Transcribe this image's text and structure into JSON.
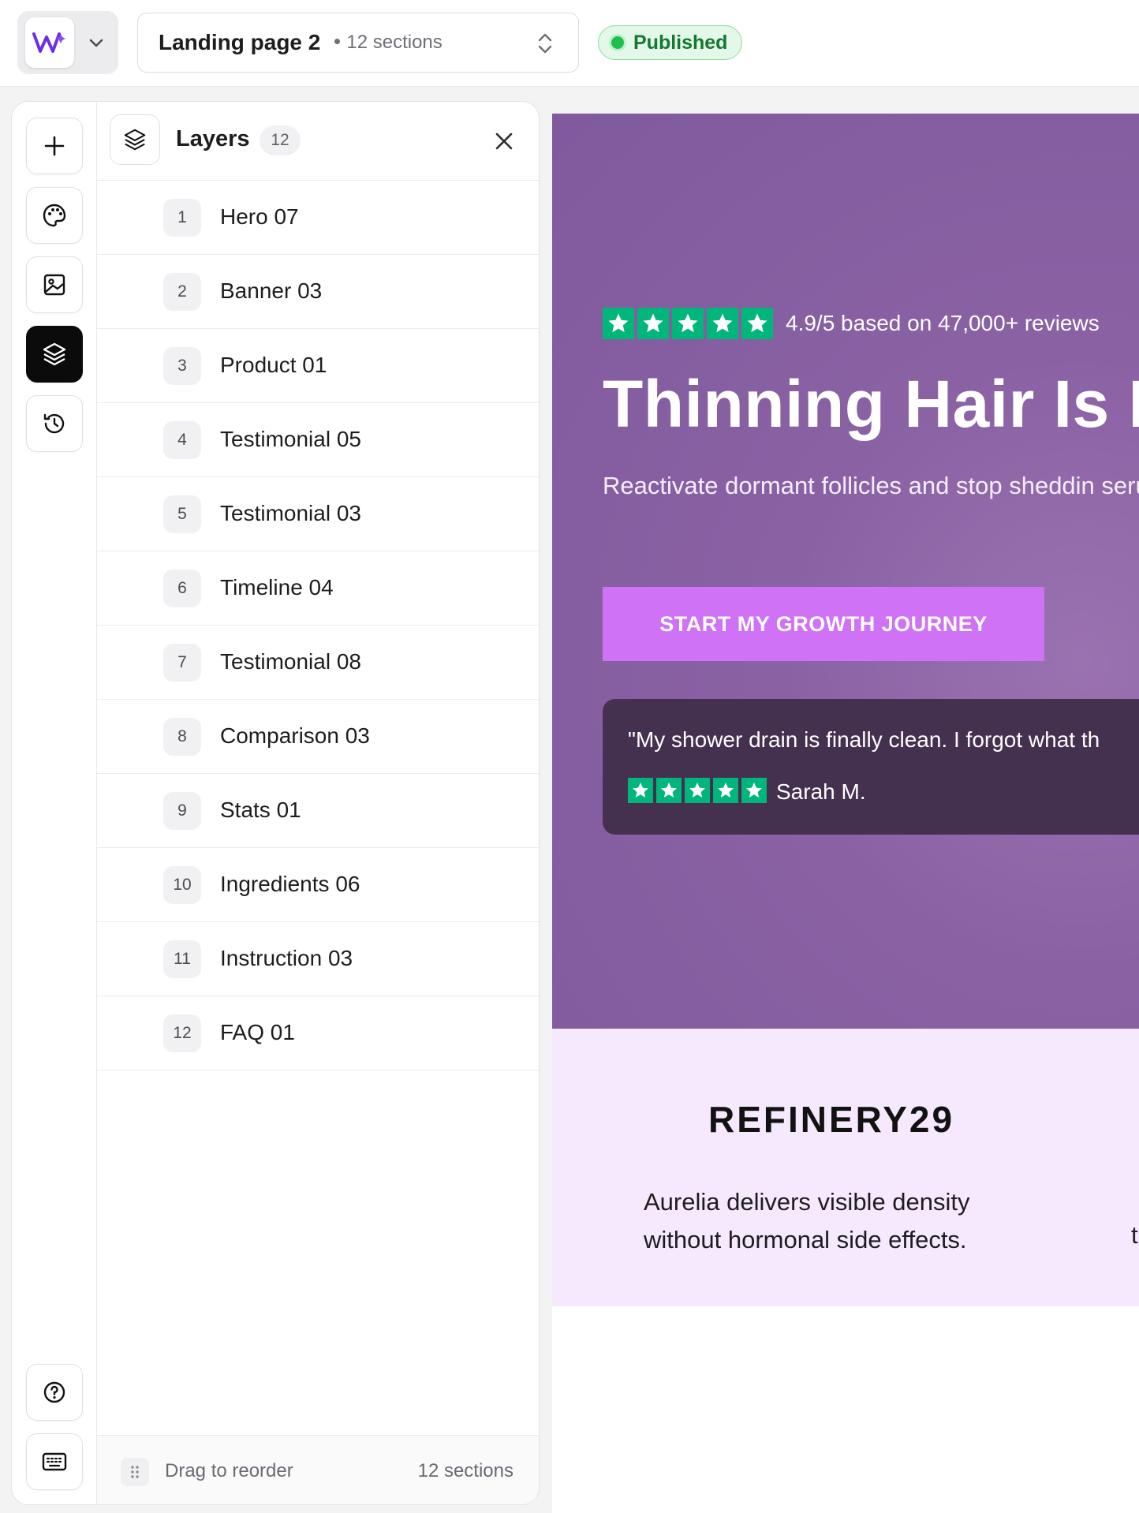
{
  "topbar": {
    "page_name": "Landing page 2",
    "page_meta": "12 sections",
    "status": "Published",
    "colors": {
      "status_bg": "#e3f8e8",
      "status_dot": "#1fbf4e",
      "brand": "#6b2ee6"
    }
  },
  "rail": {
    "buttons": [
      {
        "icon": "plus-icon"
      },
      {
        "icon": "palette-icon"
      },
      {
        "icon": "image-icon"
      },
      {
        "icon": "layers-icon",
        "active": true
      },
      {
        "icon": "history-icon"
      },
      {
        "icon": "help-icon"
      },
      {
        "icon": "keyboard-icon"
      }
    ]
  },
  "layers": {
    "title": "Layers",
    "count": "12",
    "items": [
      {
        "num": "1",
        "label": "Hero 07"
      },
      {
        "num": "2",
        "label": "Banner 03"
      },
      {
        "num": "3",
        "label": "Product 01"
      },
      {
        "num": "4",
        "label": "Testimonial 05"
      },
      {
        "num": "5",
        "label": "Testimonial 03"
      },
      {
        "num": "6",
        "label": "Timeline 04"
      },
      {
        "num": "7",
        "label": "Testimonial 08"
      },
      {
        "num": "8",
        "label": "Comparison 03"
      },
      {
        "num": "9",
        "label": "Stats 01"
      },
      {
        "num": "10",
        "label": "Ingredients 06"
      },
      {
        "num": "11",
        "label": "Instruction 03"
      },
      {
        "num": "12",
        "label": "FAQ 01"
      }
    ],
    "footer": {
      "hint": "Drag to reorder",
      "total": "12 sections"
    }
  },
  "canvas": {
    "hero": {
      "rating_text": "4.9/5 based on 47,000+ reviews",
      "title": "Thinning Hair Is Ne",
      "subtitle": "Reactivate dormant follicles and stop sheddin serum.",
      "cta": "START MY GROWTH JOURNEY",
      "quote": "\"My shower drain is finally clean. I forgot what th",
      "quote_author": "Sarah M.",
      "colors": {
        "bg": "#8a62a4",
        "cta": "#cf72f5",
        "star": "#00b67a",
        "quote_bg": "#44314f"
      }
    },
    "press": {
      "logo": "REFINERY29",
      "quote": "Aurelia delivers visible density without hormonal side effects.",
      "next_fragment": "t"
    }
  }
}
